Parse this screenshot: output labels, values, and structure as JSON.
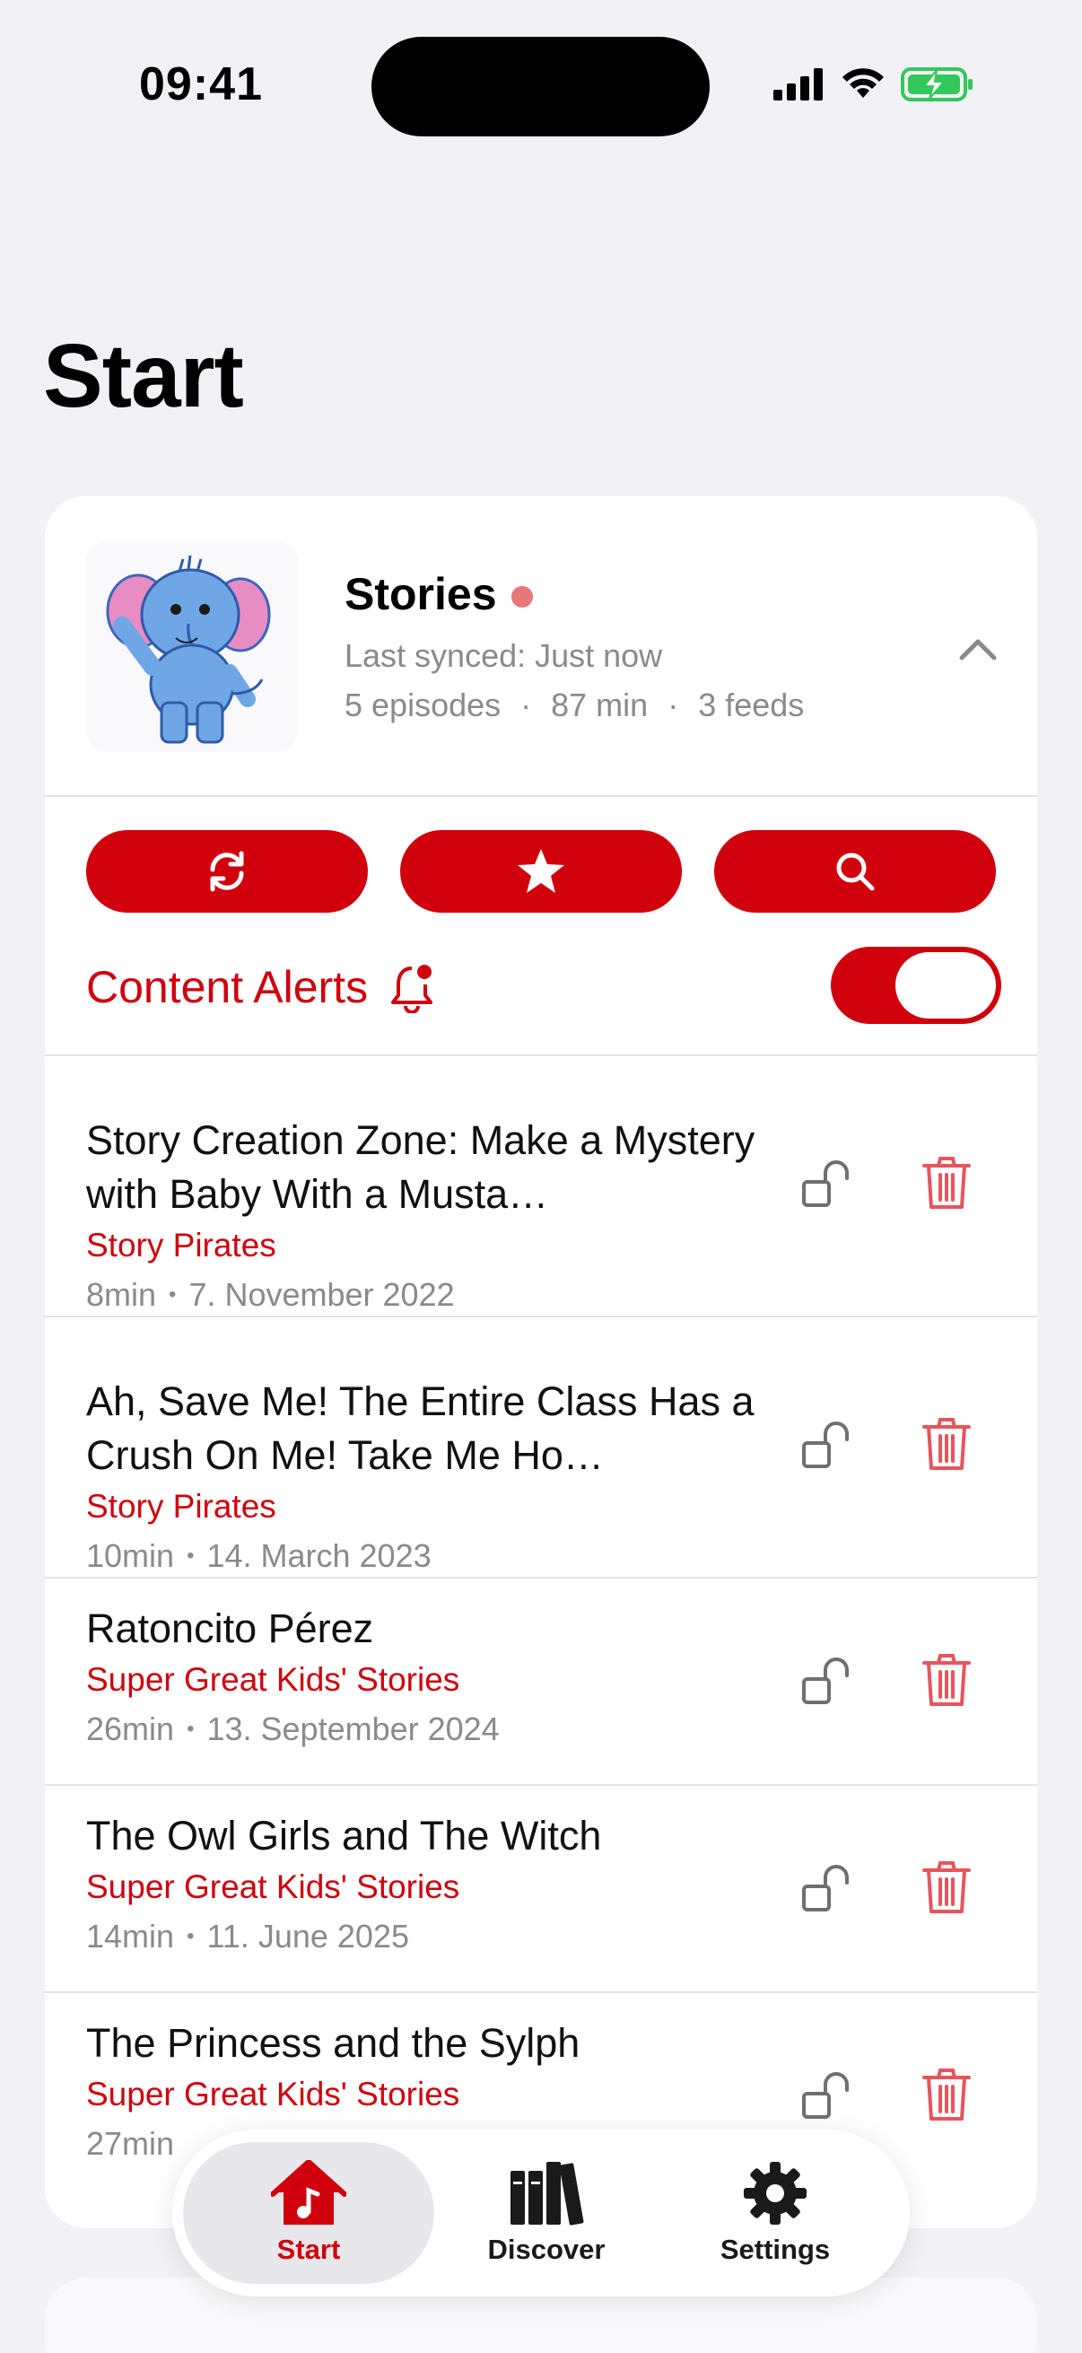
{
  "status_bar": {
    "time": "09:41"
  },
  "page": {
    "title": "Start"
  },
  "feed": {
    "name": "Stories",
    "last_synced": "Last synced: Just now",
    "episodes": "5 episodes",
    "duration": "87 min",
    "feeds": "3 feeds"
  },
  "content_alerts": {
    "label": "Content Alerts",
    "enabled": true
  },
  "episodes": [
    {
      "title": "Story Creation Zone: Make a Mystery with Baby With a Musta…",
      "feed": "Story Pirates",
      "duration": "8min",
      "date": "7. November 2022"
    },
    {
      "title": "Ah, Save Me! The Entire Class Has a Crush On Me! Take Me Ho…",
      "feed": "Story Pirates",
      "duration": "10min",
      "date": "14. March 2023"
    },
    {
      "title": "Ratoncito Pérez",
      "feed": "Super Great Kids' Stories",
      "duration": "26min",
      "date": "13. September 2024"
    },
    {
      "title": "The Owl Girls and The Witch",
      "feed": "Super Great Kids' Stories",
      "duration": "14min",
      "date": "11. June 2025"
    },
    {
      "title": "The Princess and the Sylph",
      "feed": "Super Great Kids' Stories",
      "duration": "27min",
      "date": ""
    }
  ],
  "tabs": [
    {
      "label": "Start",
      "icon": "house-music-icon",
      "active": true
    },
    {
      "label": "Discover",
      "icon": "books-icon",
      "active": false
    },
    {
      "label": "Settings",
      "icon": "gear-icon",
      "active": false
    }
  ],
  "colors": {
    "accent": "#d0000d",
    "background": "#f2f2f6",
    "secondary_text": "#8a8a8e"
  }
}
